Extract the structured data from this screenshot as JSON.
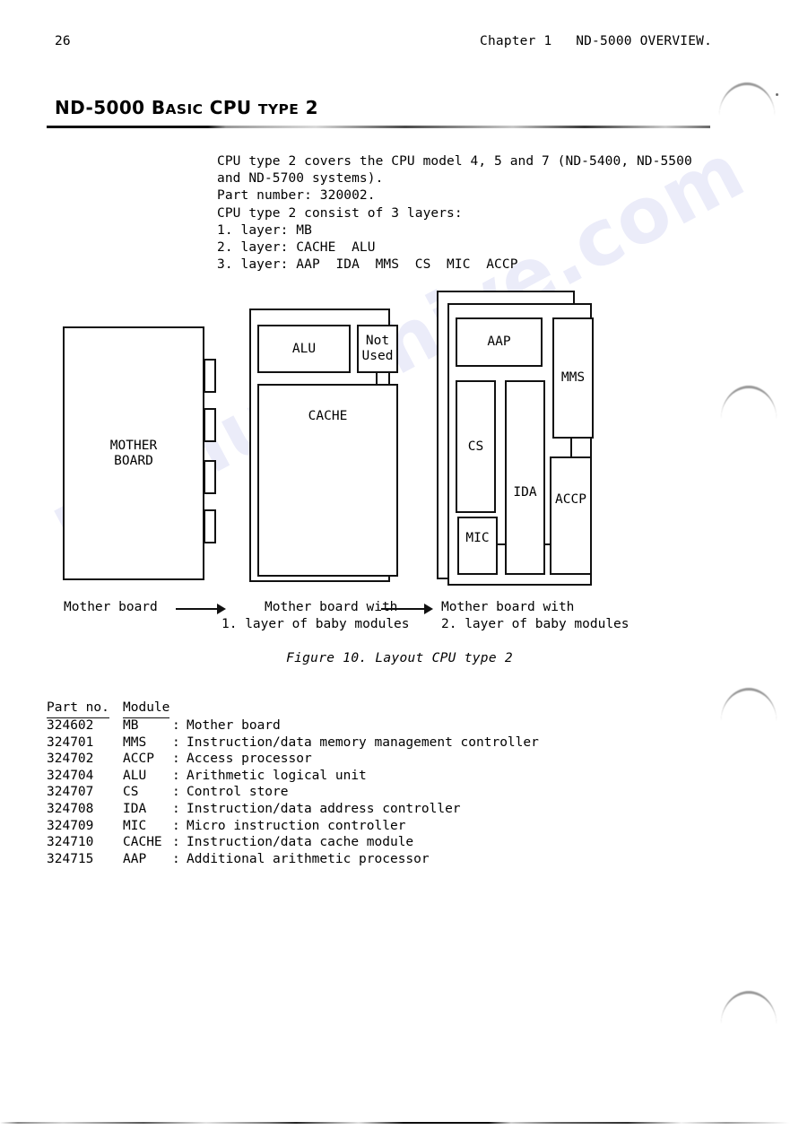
{
  "header": {
    "page_number": "26",
    "right_text": "Chapter 1   ND-5000 OVERVIEW."
  },
  "section": {
    "title_part1": "ND-5000 B",
    "title_part2": "ASIC",
    "title_part3": " CPU ",
    "title_part4": "TYPE",
    "title_part5": " 2",
    "title_full": "ND-5000 Basic CPU type 2"
  },
  "intro": {
    "lines": [
      "CPU type 2 covers the CPU model 4, 5 and 7 (ND-5400, ND-5500",
      "and ND-5700 systems).",
      "Part number: 320002.",
      "CPU type 2 consist of 3 layers:",
      "1. layer: MB",
      "2. layer: CACHE  ALU",
      "3. layer: AAP  IDA  MMS  CS  MIC  ACCP"
    ],
    "text": "CPU type 2 covers the CPU model 4, 5 and 7 (ND-5400, ND-5500\nand ND-5700 systems).\nPart number: 320002.\nCPU type 2 consist of 3 layers:\n1. layer: MB\n2. layer: CACHE  ALU\n3. layer: AAP  IDA  MMS  CS  MIC  ACCP"
  },
  "figure": {
    "boxes": {
      "mother_board": "MOTHER\nBOARD",
      "alu": "ALU",
      "not_used": "Not\nUsed",
      "cache": "CACHE",
      "aap": "AAP",
      "mms": "MMS",
      "cs": "CS",
      "ida": "IDA",
      "mic": "MIC",
      "accp": "ACCP"
    },
    "captions": {
      "left": "Mother board",
      "middle_line1": "Mother board with",
      "middle_line2": "1. layer of baby modules",
      "right_line1": "Mother board with",
      "right_line2": "2. layer of baby modules"
    },
    "label": "Figure 10. Layout CPU type 2"
  },
  "parts": {
    "headers": {
      "part_no": "Part no.",
      "module": "Module"
    },
    "rows": [
      {
        "no": "324602",
        "mod": "MB",
        "colon": ":",
        "desc": "Mother board"
      },
      {
        "no": "324701",
        "mod": "MMS",
        "colon": ":",
        "desc": "Instruction/data memory management controller"
      },
      {
        "no": "324702",
        "mod": "ACCP",
        "colon": ":",
        "desc": "Access processor"
      },
      {
        "no": "324704",
        "mod": "ALU",
        "colon": ":",
        "desc": "Arithmetic logical unit"
      },
      {
        "no": "324707",
        "mod": "CS",
        "colon": ":",
        "desc": "Control store"
      },
      {
        "no": "324708",
        "mod": "IDA",
        "colon": ":",
        "desc": "Instruction/data address controller"
      },
      {
        "no": "324709",
        "mod": "MIC",
        "colon": ":",
        "desc": "Micro instruction controller"
      },
      {
        "no": "324710",
        "mod": "CACHE",
        "colon": ":",
        "desc": "Instruction/data cache module"
      },
      {
        "no": "324715",
        "mod": "AAP",
        "colon": ":",
        "desc": "Additional arithmetic processor"
      }
    ]
  },
  "watermark": {
    "text": "manualshive.com"
  },
  "colors": {
    "ink": "#000000",
    "paper": "#ffffff",
    "watermark": "#5a5fd0"
  }
}
